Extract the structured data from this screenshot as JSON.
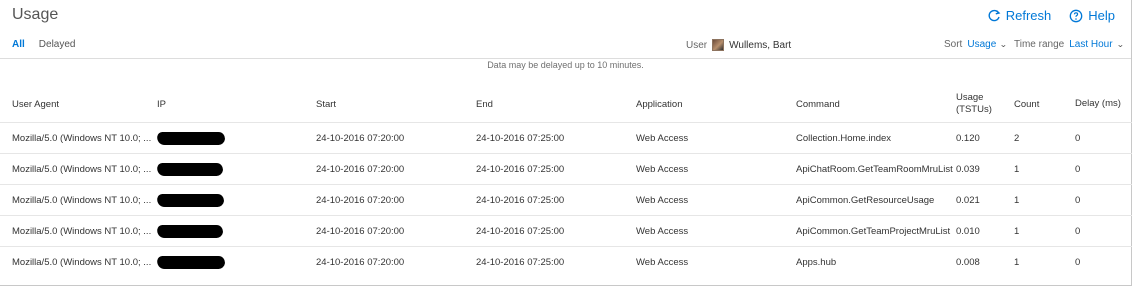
{
  "page": {
    "title": "Usage",
    "refresh": "Refresh",
    "help": "Help",
    "tabs": [
      "All",
      "Delayed"
    ],
    "active_tab": "All"
  },
  "filters": {
    "user_label": "User",
    "user_name": "Wullems, Bart",
    "sort_label": "Sort",
    "sort_value": "Usage",
    "time_label": "Time range",
    "time_value": "Last Hour"
  },
  "notice": "Data may be delayed up to 10 minutes.",
  "table": {
    "headers": [
      "User Agent",
      "IP",
      "Start",
      "End",
      "Application",
      "Command",
      "Usage (TSTUs)",
      "Count",
      "Delay (ms)"
    ],
    "rows": [
      {
        "user_agent": "Mozilla/5.0 (Windows NT 10.0; ...",
        "start": "24-10-2016 07:20:00",
        "end": "24-10-2016 07:25:00",
        "application": "Web Access",
        "command": "Collection.Home.index",
        "usage": "0.120",
        "count": "2",
        "delay": "0"
      },
      {
        "user_agent": "Mozilla/5.0 (Windows NT 10.0; ...",
        "start": "24-10-2016 07:20:00",
        "end": "24-10-2016 07:25:00",
        "application": "Web Access",
        "command": "ApiChatRoom.GetTeamRoomMruList",
        "usage": "0.039",
        "count": "1",
        "delay": "0"
      },
      {
        "user_agent": "Mozilla/5.0 (Windows NT 10.0; ...",
        "start": "24-10-2016 07:20:00",
        "end": "24-10-2016 07:25:00",
        "application": "Web Access",
        "command": "ApiCommon.GetResourceUsage",
        "usage": "0.021",
        "count": "1",
        "delay": "0"
      },
      {
        "user_agent": "Mozilla/5.0 (Windows NT 10.0; ...",
        "start": "24-10-2016 07:20:00",
        "end": "24-10-2016 07:25:00",
        "application": "Web Access",
        "command": "ApiCommon.GetTeamProjectMruList",
        "usage": "0.010",
        "count": "1",
        "delay": "0"
      },
      {
        "user_agent": "Mozilla/5.0 (Windows NT 10.0; ...",
        "start": "24-10-2016 07:20:00",
        "end": "24-10-2016 07:25:00",
        "application": "Web Access",
        "command": "Apps.hub",
        "usage": "0.008",
        "count": "1",
        "delay": "0"
      }
    ]
  },
  "colors": {
    "accent": "#0078d7",
    "text": "#333333",
    "muted": "#707070",
    "border": "#e6e6e6",
    "redaction": "#000000"
  },
  "icons": {
    "refresh": "refresh-icon",
    "help": "help-icon",
    "avatar": "avatar",
    "chevron": "chevron-down-icon"
  }
}
